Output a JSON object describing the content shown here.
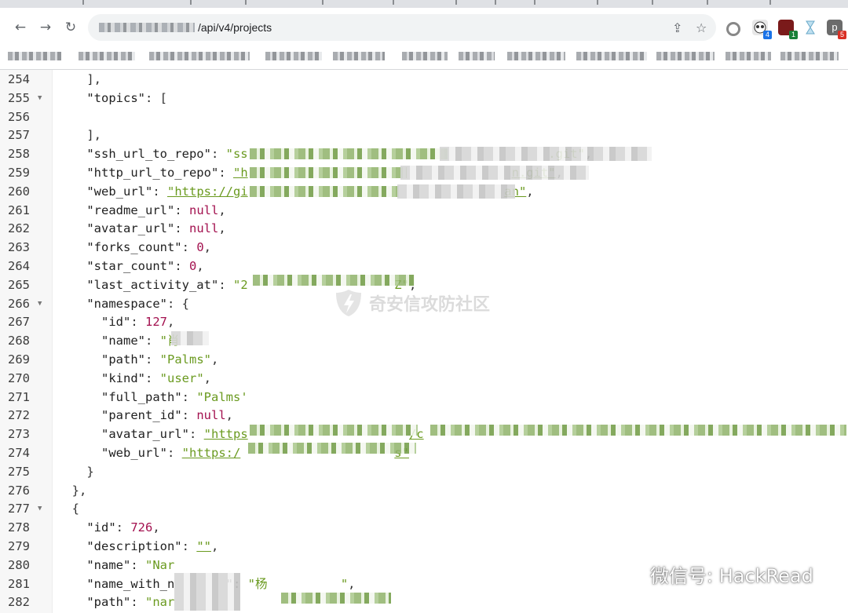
{
  "browser": {
    "url_path": "/api/v4/projects",
    "nav": {
      "back": "←",
      "forward": "→",
      "reload": "↻"
    },
    "omnibox_icons": {
      "share": "⇪",
      "bookmark": "☆"
    },
    "extensions": [
      {
        "name": "circle-extension",
        "badge": ""
      },
      {
        "name": "panda-extension",
        "badge": "4",
        "badge_color": "#1a73e8"
      },
      {
        "name": "red-extension",
        "badge": "1",
        "badge_color": "#188038"
      },
      {
        "name": "hourglass-extension",
        "badge": ""
      },
      {
        "name": "p-extension",
        "label": "p",
        "badge": "5",
        "badge_color": "#d93025"
      }
    ]
  },
  "code_lines": [
    {
      "n": "254",
      "fold": false,
      "indent": 4,
      "tokens": [
        {
          "t": "p",
          "v": "],"
        }
      ]
    },
    {
      "n": "255",
      "fold": true,
      "indent": 4,
      "tokens": [
        {
          "t": "k",
          "v": "\"topics\""
        },
        {
          "t": "p",
          "v": ": ["
        }
      ]
    },
    {
      "n": "256",
      "fold": false,
      "indent": 0,
      "tokens": []
    },
    {
      "n": "257",
      "fold": false,
      "indent": 4,
      "tokens": [
        {
          "t": "p",
          "v": "],"
        }
      ]
    },
    {
      "n": "258",
      "fold": false,
      "indent": 4,
      "tokens": [
        {
          "t": "k",
          "v": "\"ssh_url_to_repo\""
        },
        {
          "t": "p",
          "v": ": "
        },
        {
          "t": "s",
          "v": "\"ss"
        },
        {
          "t": "gap",
          "v": "                                         "
        },
        {
          "t": "s",
          "v": ".git\""
        },
        {
          "t": "p",
          "v": ","
        }
      ]
    },
    {
      "n": "259",
      "fold": false,
      "indent": 4,
      "tokens": [
        {
          "t": "k",
          "v": "\"http_url_to_repo\""
        },
        {
          "t": "p",
          "v": ": "
        },
        {
          "t": "u",
          "v": "\"h"
        },
        {
          "t": "gap",
          "v": "                                    "
        },
        {
          "t": "u",
          "v": "n.git\""
        },
        {
          "t": "p",
          "v": ","
        }
      ]
    },
    {
      "n": "260",
      "fold": false,
      "indent": 4,
      "tokens": [
        {
          "t": "k",
          "v": "\"web_url\""
        },
        {
          "t": "p",
          "v": ": "
        },
        {
          "t": "u",
          "v": "\"https://gi"
        },
        {
          "t": "gap",
          "v": "                                   "
        },
        {
          "t": "u",
          "v": "an\""
        },
        {
          "t": "p",
          "v": ","
        }
      ]
    },
    {
      "n": "261",
      "fold": false,
      "indent": 4,
      "tokens": [
        {
          "t": "k",
          "v": "\"readme_url\""
        },
        {
          "t": "p",
          "v": ": "
        },
        {
          "t": "l",
          "v": "null"
        },
        {
          "t": "p",
          "v": ","
        }
      ]
    },
    {
      "n": "262",
      "fold": false,
      "indent": 4,
      "tokens": [
        {
          "t": "k",
          "v": "\"avatar_url\""
        },
        {
          "t": "p",
          "v": ": "
        },
        {
          "t": "l",
          "v": "null"
        },
        {
          "t": "p",
          "v": ","
        }
      ]
    },
    {
      "n": "263",
      "fold": false,
      "indent": 4,
      "tokens": [
        {
          "t": "k",
          "v": "\"forks_count\""
        },
        {
          "t": "p",
          "v": ": "
        },
        {
          "t": "n",
          "v": "0"
        },
        {
          "t": "p",
          "v": ","
        }
      ]
    },
    {
      "n": "264",
      "fold": false,
      "indent": 4,
      "tokens": [
        {
          "t": "k",
          "v": "\"star_count\""
        },
        {
          "t": "p",
          "v": ": "
        },
        {
          "t": "n",
          "v": "0"
        },
        {
          "t": "p",
          "v": ","
        }
      ]
    },
    {
      "n": "265",
      "fold": false,
      "indent": 4,
      "tokens": [
        {
          "t": "k",
          "v": "\"last_activity_at\""
        },
        {
          "t": "p",
          "v": ": "
        },
        {
          "t": "s",
          "v": "\"2"
        },
        {
          "t": "gap",
          "v": "                    "
        },
        {
          "t": "s",
          "v": "Z\""
        },
        {
          "t": "p",
          "v": ","
        }
      ]
    },
    {
      "n": "266",
      "fold": true,
      "indent": 4,
      "tokens": [
        {
          "t": "k",
          "v": "\"namespace\""
        },
        {
          "t": "p",
          "v": ": {"
        }
      ]
    },
    {
      "n": "267",
      "fold": false,
      "indent": 6,
      "tokens": [
        {
          "t": "k",
          "v": "\"id\""
        },
        {
          "t": "p",
          "v": ": "
        },
        {
          "t": "n",
          "v": "127"
        },
        {
          "t": "p",
          "v": ","
        }
      ]
    },
    {
      "n": "268",
      "fold": false,
      "indent": 6,
      "tokens": [
        {
          "t": "k",
          "v": "\"name\""
        },
        {
          "t": "p",
          "v": ": "
        },
        {
          "t": "s",
          "v": "\"肖"
        }
      ]
    },
    {
      "n": "269",
      "fold": false,
      "indent": 6,
      "tokens": [
        {
          "t": "k",
          "v": "\"path\""
        },
        {
          "t": "p",
          "v": ": "
        },
        {
          "t": "s",
          "v": "\"Palms\""
        },
        {
          "t": "p",
          "v": ","
        }
      ]
    },
    {
      "n": "270",
      "fold": false,
      "indent": 6,
      "tokens": [
        {
          "t": "k",
          "v": "\"kind\""
        },
        {
          "t": "p",
          "v": ": "
        },
        {
          "t": "s",
          "v": "\"user\""
        },
        {
          "t": "p",
          "v": ","
        }
      ]
    },
    {
      "n": "271",
      "fold": false,
      "indent": 6,
      "tokens": [
        {
          "t": "k",
          "v": "\"full_path\""
        },
        {
          "t": "p",
          "v": ": "
        },
        {
          "t": "s",
          "v": "\"Palms'"
        }
      ]
    },
    {
      "n": "272",
      "fold": false,
      "indent": 6,
      "tokens": [
        {
          "t": "k",
          "v": "\"parent_id\""
        },
        {
          "t": "p",
          "v": ": "
        },
        {
          "t": "l",
          "v": "null"
        },
        {
          "t": "p",
          "v": ","
        }
      ]
    },
    {
      "n": "273",
      "fold": false,
      "indent": 6,
      "tokens": [
        {
          "t": "k",
          "v": "\"avatar_url\""
        },
        {
          "t": "p",
          "v": ": "
        },
        {
          "t": "u",
          "v": "\"https"
        },
        {
          "t": "gap",
          "v": "                      "
        },
        {
          "t": "u",
          "v": "/c"
        }
      ]
    },
    {
      "n": "274",
      "fold": false,
      "indent": 6,
      "tokens": [
        {
          "t": "k",
          "v": "\"web_url\""
        },
        {
          "t": "p",
          "v": ": "
        },
        {
          "t": "u",
          "v": "\"https:/"
        },
        {
          "t": "gap",
          "v": "                     "
        },
        {
          "t": "u",
          "v": "s\""
        }
      ]
    },
    {
      "n": "275",
      "fold": false,
      "indent": 4,
      "tokens": [
        {
          "t": "p",
          "v": "}"
        }
      ]
    },
    {
      "n": "276",
      "fold": false,
      "indent": 2,
      "tokens": [
        {
          "t": "p",
          "v": "},"
        }
      ]
    },
    {
      "n": "277",
      "fold": true,
      "indent": 2,
      "tokens": [
        {
          "t": "p",
          "v": "{"
        }
      ]
    },
    {
      "n": "278",
      "fold": false,
      "indent": 4,
      "tokens": [
        {
          "t": "k",
          "v": "\"id\""
        },
        {
          "t": "p",
          "v": ": "
        },
        {
          "t": "n",
          "v": "726"
        },
        {
          "t": "p",
          "v": ","
        }
      ]
    },
    {
      "n": "279",
      "fold": false,
      "indent": 4,
      "tokens": [
        {
          "t": "k",
          "v": "\"description\""
        },
        {
          "t": "p",
          "v": ": "
        },
        {
          "t": "u",
          "v": "\"\""
        },
        {
          "t": "p",
          "v": ","
        }
      ]
    },
    {
      "n": "280",
      "fold": false,
      "indent": 4,
      "tokens": [
        {
          "t": "k",
          "v": "\"name\""
        },
        {
          "t": "p",
          "v": ": "
        },
        {
          "t": "s",
          "v": "\"Nar"
        }
      ]
    },
    {
      "n": "281",
      "fold": false,
      "indent": 4,
      "tokens": [
        {
          "t": "k",
          "v": "\"name_with_n"
        },
        {
          "t": "gap",
          "v": "       "
        },
        {
          "t": "p",
          "v": "\": "
        },
        {
          "t": "s",
          "v": "\"杨"
        },
        {
          "t": "gap",
          "v": "          "
        },
        {
          "t": "s",
          "v": "\""
        },
        {
          "t": "p",
          "v": ","
        }
      ]
    },
    {
      "n": "282",
      "fold": false,
      "indent": 4,
      "tokens": [
        {
          "t": "k",
          "v": "\"path\""
        },
        {
          "t": "p",
          "v": ": "
        },
        {
          "t": "s",
          "v": "\"nar"
        }
      ]
    }
  ],
  "watermarks": {
    "site": "奇安信攻防社区",
    "wechat": "微信号: HackRead"
  }
}
